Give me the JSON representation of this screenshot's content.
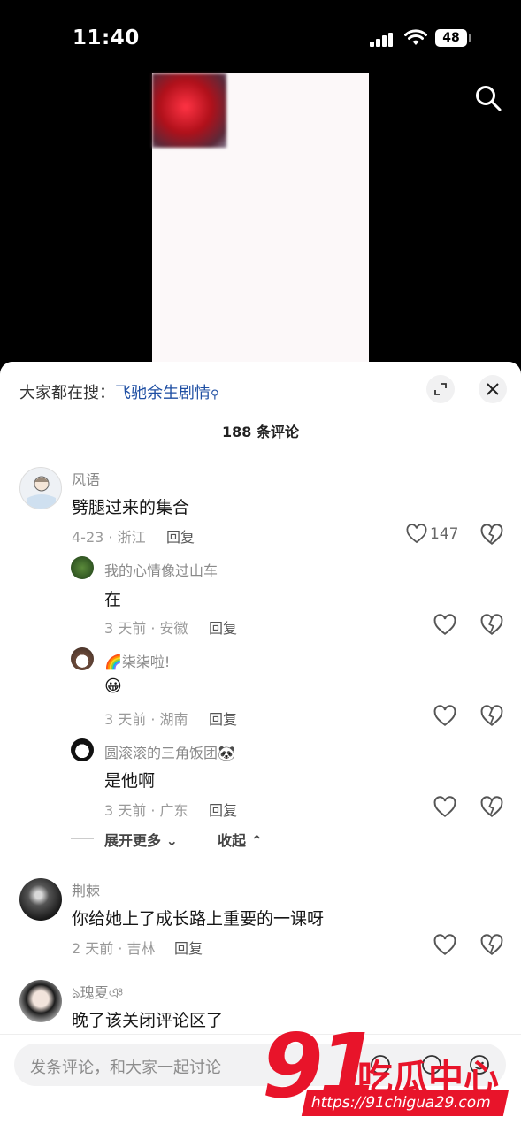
{
  "status_bar": {
    "time": "11:40",
    "battery": "48"
  },
  "sheet": {
    "search_prefix": "大家都在搜：",
    "search_keyword": "飞驰余生剧情",
    "comment_count": "188 条评论"
  },
  "comments": [
    {
      "user": "风语",
      "text": "劈腿过来的集合",
      "meta": "4-23 · 浙江",
      "reply_label": "回复",
      "likes": "147",
      "replies": [
        {
          "user": "我的心情像过山车",
          "text": "在",
          "meta": "3 天前 · 安徽",
          "reply_label": "回复"
        },
        {
          "user": "🌈柒柒啦!",
          "text": "😀",
          "meta": "3 天前 · 湖南",
          "reply_label": "回复"
        },
        {
          "user": "圆滚滚的三角饭团🐼",
          "text": "是他啊",
          "meta": "3 天前 · 广东",
          "reply_label": "回复"
        }
      ],
      "expand_more": "展开更多",
      "collapse": "收起"
    },
    {
      "user": "荆棘",
      "text": "你给她上了成长路上重要的一课呀",
      "meta": "2 天前 · 吉林",
      "reply_label": "回复"
    },
    {
      "user": "ঌ瑰夏ঞ",
      "text": "晚了该关闭评论区了"
    }
  ],
  "input": {
    "placeholder": "发条评论，和大家一起讨论"
  },
  "watermark": {
    "logo_number": "91",
    "logo_text": "吃瓜中心",
    "url": "https://91chigua29.com"
  },
  "colors": {
    "keyword_link": "#1f4fa3",
    "watermark": "#e8142a"
  }
}
